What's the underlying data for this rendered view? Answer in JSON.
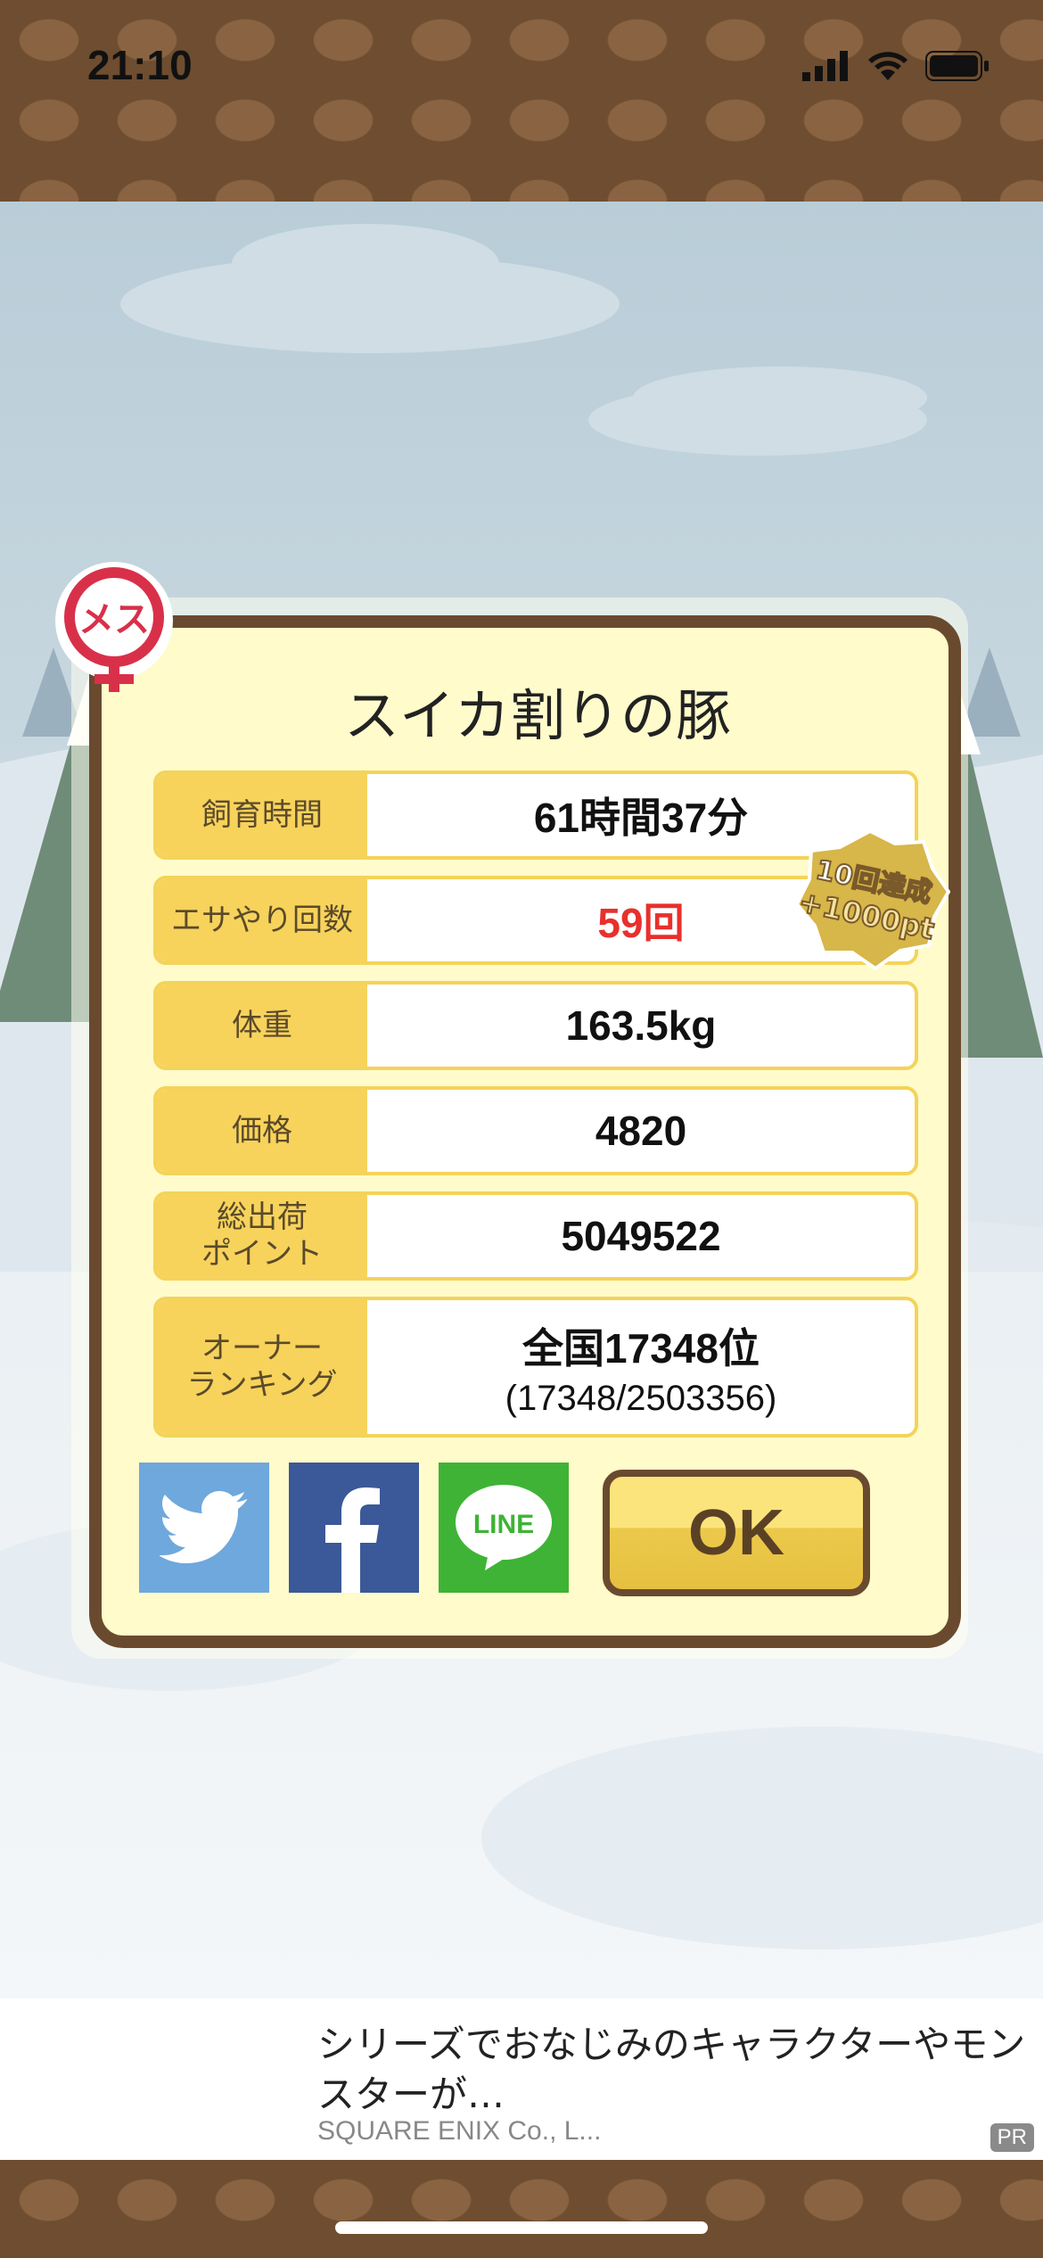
{
  "status_bar": {
    "time": "21:10"
  },
  "dialog": {
    "title": "スイカ割りの豚",
    "rows": [
      {
        "label": "飼育時間",
        "value": "61時間37分"
      },
      {
        "label": "エサやり回数",
        "value": "59回"
      },
      {
        "label": "体重",
        "value": "163.5kg"
      },
      {
        "label": "価格",
        "value": "4820"
      },
      {
        "label": "総出荷\nポイント",
        "value": "5049522"
      },
      {
        "label": "オーナー\nランキング",
        "value": "全国17348位",
        "sub": "(17348/2503356)"
      }
    ],
    "badge": {
      "line1": "10回達成",
      "line2": "+1000pt"
    },
    "sex_label": "メス",
    "ok_label": "OK",
    "social": {
      "line_label": "LINE"
    }
  },
  "ad": {
    "text": "シリーズでおなじみのキャラクターやモンスターが…",
    "company": "SQUARE ENIX Co., L...",
    "pr": "PR"
  },
  "colors": {
    "accent": "#f7d35c",
    "frame": "#6a4a2e",
    "highlight": "#e8302c"
  }
}
